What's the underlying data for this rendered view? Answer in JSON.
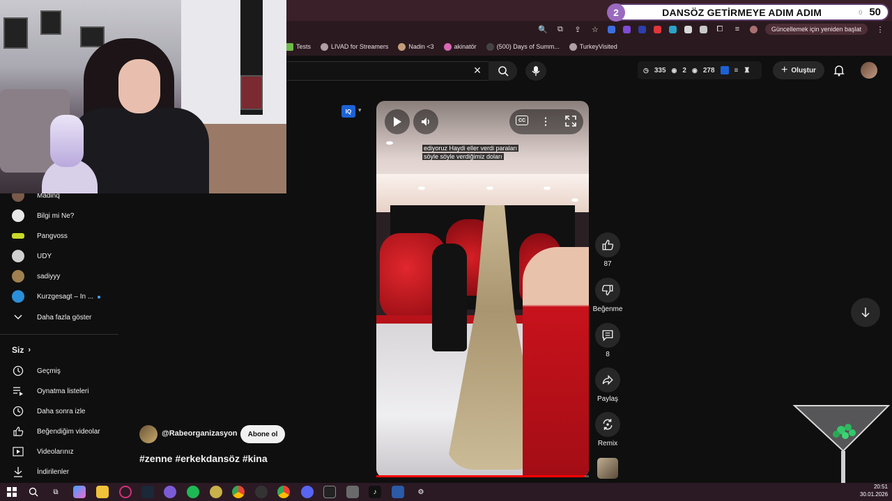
{
  "overlay": {
    "goal_number": "2",
    "goal_title": "DANSÖZ GETİRMEYE ADIM ADIM",
    "goal_count": "50",
    "goal_mini": "0"
  },
  "browser": {
    "update_button": "Güncellemek için yeniden başlat",
    "bookmarks": [
      "Tests",
      "LIVAD for Streamers",
      "Nadin <3",
      "akinatör",
      "(500) Days of Summ...",
      "TurkeyVisited"
    ]
  },
  "header": {
    "stats": {
      "a": "335",
      "b": "2",
      "c": "278"
    },
    "create_label": "Oluştur"
  },
  "sidebar": {
    "subscriptions": [
      {
        "label": "Madinq",
        "color": "#7a5a4a"
      },
      {
        "label": "Bilgi mi Ne?",
        "color": "#e8e8e8"
      },
      {
        "label": "Pangvoss",
        "color": "#c8d82a"
      },
      {
        "label": "UDY",
        "color": "#d0d0d0"
      },
      {
        "label": "sadiyyy",
        "color": "#a08050"
      },
      {
        "label": "Kurzgesagt – In ...",
        "color": "#2a8fd8"
      }
    ],
    "show_more": "Daha fazla göster",
    "you_title": "Siz",
    "you_items": [
      "Geçmiş",
      "Oynatma listeleri",
      "Daha sonra izle",
      "Beğendiğim videolar",
      "Videolarınız",
      "İndirilenler"
    ]
  },
  "short": {
    "iq_badge": "IQ",
    "cc_label": "CC",
    "caption_line1": "ediyoruz Haydi eller verdi paraları",
    "caption_line2": "söyle söyle verdiğimiz doları",
    "progress": 0.98,
    "channel": "@Rabeorganizasyon",
    "subscribe": "Abone ol",
    "hashtags": "#zenne #erkekdansöz #kina"
  },
  "actions": {
    "like_count": "87",
    "dislike_label": "Beğenme",
    "comment_count": "8",
    "share_label": "Paylaş",
    "remix_label": "Remix"
  },
  "taskbar": {
    "time": "20:51",
    "date": "30.01.2026"
  },
  "colors": {
    "accent_red": "#ff0000",
    "goal_purple": "#9a6abf"
  }
}
